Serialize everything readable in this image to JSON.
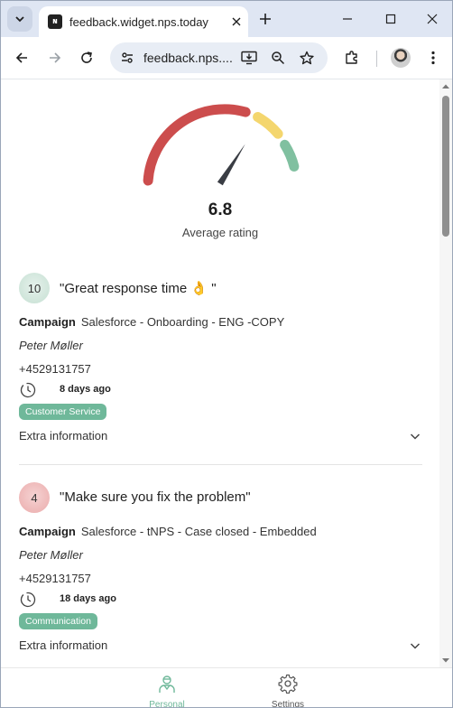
{
  "browser": {
    "tab_title": "feedback.widget.nps.today",
    "url_display": "feedback.nps...."
  },
  "rating": {
    "value": "6.8",
    "label": "Average rating",
    "needle_value": 6.8,
    "scale_max": 10,
    "colors": {
      "low": "#cc4d4d",
      "mid": "#f4d66e",
      "high": "#80c0a0",
      "needle": "#3a3d44"
    }
  },
  "feedback": [
    {
      "score": "10",
      "score_color": "green",
      "quote": "\"Great response time 👌 \"",
      "campaign_label": "Campaign",
      "campaign_value": "Salesforce - Onboarding - ENG -COPY",
      "person": "Peter Møller",
      "phone": "+4529131757",
      "time_ago": "8 days ago",
      "tag": "Customer Service",
      "extra_label": "Extra information"
    },
    {
      "score": "4",
      "score_color": "red",
      "quote": "\"Make sure you fix the problem\"",
      "campaign_label": "Campaign",
      "campaign_value": "Salesforce - tNPS - Case closed - Embedded",
      "person": "Peter Møller",
      "phone": "+4529131757",
      "time_ago": "18 days ago",
      "tag": "Communication",
      "extra_label": "Extra information"
    }
  ],
  "bottom_nav": {
    "personal_label": "Personal",
    "settings_label": "Settings",
    "active_color": "#6fb89a",
    "inactive_color": "#555555"
  }
}
